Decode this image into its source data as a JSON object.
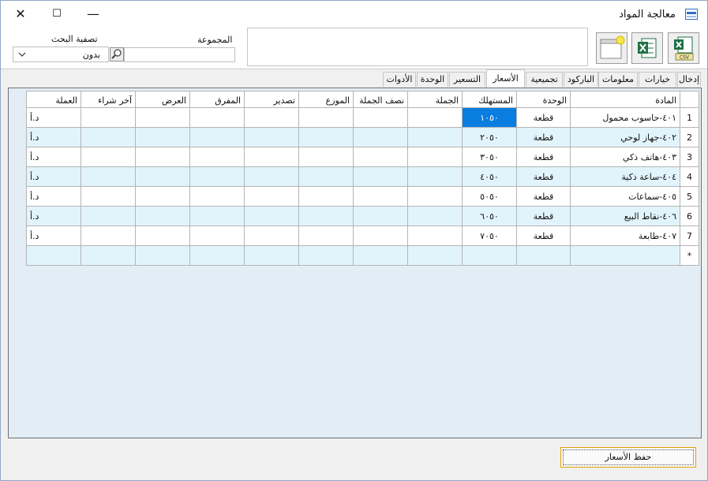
{
  "window": {
    "title": "معالجة المواد",
    "minimize": "—",
    "maximize": "☐",
    "close": "✕"
  },
  "filters": {
    "search_filter_label": "تصفية البحث",
    "search_filter_value": "بدون",
    "group_label": "المجموعة",
    "group_value": ""
  },
  "toolbar": {
    "csv": "CSV"
  },
  "tabs": [
    "إدخال",
    "خيارات",
    "معلومات",
    "الباركود",
    "تجميعية",
    "الأسعار",
    "التسعير",
    "الوحدة",
    "الأدوات"
  ],
  "active_tab": "الأسعار",
  "grid": {
    "columns": [
      "المادة",
      "الوحدة",
      "المستهلك",
      "الجملة",
      "نصف الجملة",
      "الموزع",
      "تصدير",
      "المفرق",
      "العرض",
      "آخر شراء",
      "العملة"
    ],
    "rows": [
      {
        "num": "1",
        "item": "٤٠١-حاسوب محمول",
        "unit": "قطعة",
        "consumer": "١٠٥٠",
        "currency": "د.أ"
      },
      {
        "num": "2",
        "item": "٤٠٢-جهاز لوحي",
        "unit": "قطعة",
        "consumer": "٢٠٥٠",
        "currency": "د.أ"
      },
      {
        "num": "3",
        "item": "٤٠٣-هاتف ذكي",
        "unit": "قطعة",
        "consumer": "٣٠٥٠",
        "currency": "د.أ"
      },
      {
        "num": "4",
        "item": "٤٠٤-ساعة ذكية",
        "unit": "قطعة",
        "consumer": "٤٠٥٠",
        "currency": "د.أ"
      },
      {
        "num": "5",
        "item": "٤٠٥-سماعات",
        "unit": "قطعة",
        "consumer": "٥٠٥٠",
        "currency": "د.أ"
      },
      {
        "num": "6",
        "item": "٤٠٦-نقاط البيع",
        "unit": "قطعة",
        "consumer": "٦٠٥٠",
        "currency": "د.أ"
      },
      {
        "num": "7",
        "item": "٤٠٧-طابعة",
        "unit": "قطعة",
        "consumer": "٧٠٥٠",
        "currency": "د.أ"
      }
    ],
    "new_row_marker": "*"
  },
  "footer": {
    "save_prices": "حفظ الأسعار"
  }
}
